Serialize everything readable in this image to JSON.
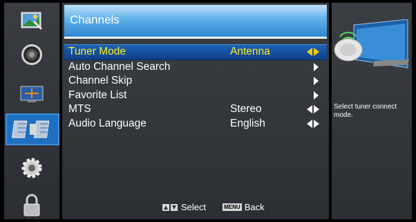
{
  "window": {
    "title": "Channels"
  },
  "menu": {
    "items": [
      {
        "label": "Tuner Mode",
        "value": "Antenna",
        "control": "left-right-arrows-icon"
      },
      {
        "label": "Auto Channel Search",
        "value": "",
        "control": "right-arrow-icon"
      },
      {
        "label": "Channel Skip",
        "value": "",
        "control": "right-arrow-icon"
      },
      {
        "label": "Favorite List",
        "value": "",
        "control": "right-arrow-icon"
      },
      {
        "label": "MTS",
        "value": "Stereo",
        "control": "left-right-arrows-icon"
      },
      {
        "label": "Audio Language",
        "value": "English",
        "control": "left-right-arrows-icon"
      }
    ],
    "selected_index": 0
  },
  "footer": {
    "select_label": "Select",
    "menu_key": "MENU",
    "back_label": "Back"
  },
  "info": {
    "text": "Select tuner connect mode."
  },
  "sidebar": {
    "icons": [
      "picture-icon",
      "audio-icon",
      "tv-screen-icon",
      "satellite-icon",
      "settings-gear-icon",
      "lock-icon"
    ],
    "active_index": 3
  },
  "colors": {
    "accent": "#1f6fbf",
    "selected_text": "#ffee22"
  }
}
